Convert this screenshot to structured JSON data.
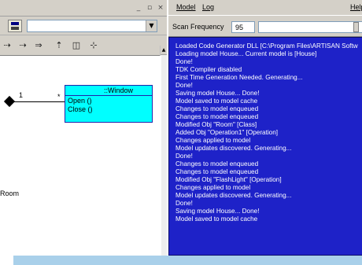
{
  "left_window": {
    "controls": [
      "_",
      "▫",
      "×"
    ],
    "toolbar_tools": [
      "⇢",
      "⇢",
      "⇒",
      "⇡",
      "◫",
      "⊹"
    ]
  },
  "diagram": {
    "class_name": "::Window",
    "operations": [
      "Open ()",
      "Close ()"
    ],
    "association": {
      "near_end": "1",
      "far_end": "*"
    },
    "partial_label": "Room"
  },
  "log_window": {
    "menu": {
      "model": "Model",
      "log": "Log",
      "help": "Help"
    },
    "scan_label": "Scan Frequency",
    "scan_value": "95",
    "slider_level": 0.95,
    "log_background": "#1e22c8",
    "log_lines": [
      "Loaded Code Generator DLL [C:\\Program Files\\ARTISAN Softw",
      "Loading model House... Current model is [House]",
      "Done!",
      "TDK Compiler disabled",
      "First Time Generation Needed. Generating...",
      "Done!",
      "Saving model House... Done!",
      "Model saved to model cache",
      "Changes to model enqueued",
      "Changes to model enqueued",
      "Modified Obj \"Room\" [Class]",
      "Added Obj \"Operation1\" [Operation]",
      "Changes applied to model",
      "Model updates discovered. Generating...",
      "Done!",
      "Changes to model enqueued",
      "Changes to model enqueued",
      "Modified Obj \"FlashLight\" [Operation]",
      "Changes applied to model",
      "Model updates discovered. Generating...",
      "Done!",
      "Saving model House... Done!",
      "Model saved to model cache"
    ]
  }
}
